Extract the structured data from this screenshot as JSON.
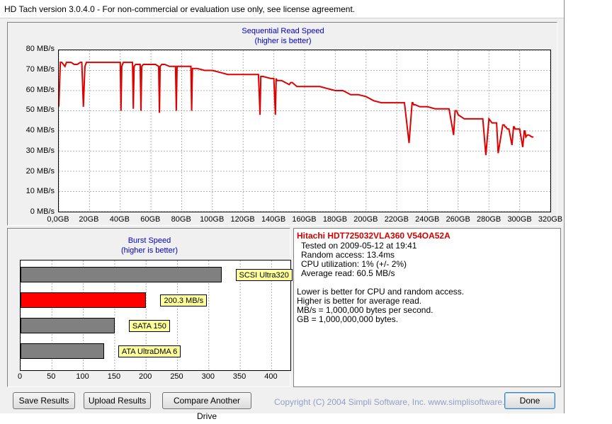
{
  "window": {
    "title": "HD Tach version 3.0.4.0  - For non-commercial or evaluation use only, see license agreement."
  },
  "sequential_chart": {
    "title": "Sequential Read Speed",
    "subtitle": "(higher is better)",
    "y_ticks": [
      "80 MB/s",
      "70 MB/s",
      "60 MB/s",
      "50 MB/s",
      "40 MB/s",
      "30 MB/s",
      "20 MB/s",
      "10 MB/s",
      "0 MB/s"
    ],
    "x_ticks": [
      "0,0GB",
      "20GB",
      "40GB",
      "60GB",
      "80GB",
      "100GB",
      "120GB",
      "140GB",
      "160GB",
      "180GB",
      "200GB",
      "220GB",
      "240GB",
      "260GB",
      "280GB",
      "300GB",
      "320GB"
    ]
  },
  "burst_chart": {
    "title": "Burst Speed",
    "subtitle": "(higher is better)",
    "x_ticks": [
      "0",
      "50",
      "100",
      "150",
      "200",
      "250",
      "300",
      "350",
      "400"
    ]
  },
  "chart_data": [
    {
      "type": "line",
      "title": "Sequential Read Speed",
      "subtitle": "(higher is better)",
      "xlabel": "",
      "ylabel": "",
      "xlim": [
        0,
        320
      ],
      "ylim": [
        0,
        80
      ],
      "grid": true,
      "color": "#e00000",
      "x": [
        0,
        1,
        2,
        4,
        5,
        6,
        8,
        10,
        12,
        14,
        15,
        16,
        17,
        18,
        20,
        30,
        40,
        40.5,
        41,
        42,
        48,
        48.5,
        49,
        50,
        53,
        53.5,
        54,
        55,
        60,
        63,
        65,
        65.5,
        66,
        67,
        69,
        72,
        75,
        76,
        76.5,
        77,
        78,
        80,
        82,
        85,
        86,
        86.5,
        87,
        88,
        90,
        95,
        100,
        105,
        110,
        118,
        125,
        130,
        131,
        131.5,
        132,
        133,
        138,
        140,
        141,
        141.5,
        142,
        143,
        145,
        150,
        151,
        152,
        155,
        160,
        165,
        170,
        175,
        180,
        185,
        190,
        195,
        200,
        205,
        210,
        220,
        225,
        228,
        230,
        230.5,
        231,
        232,
        235,
        240,
        245,
        250,
        254,
        257,
        258,
        258.5,
        259,
        260,
        264,
        270,
        275,
        276,
        278,
        280,
        282,
        283,
        284,
        285,
        286,
        289,
        290,
        290.5,
        291,
        292,
        293,
        295,
        296,
        296.5,
        297,
        298,
        300,
        302,
        303,
        303.5,
        304,
        305,
        306,
        308,
        309,
        309.5,
        310,
        312,
        315,
        318,
        320
      ],
      "y": [
        52,
        74,
        74,
        72,
        74,
        74,
        74,
        73,
        73,
        74,
        74,
        52,
        72,
        74,
        74,
        74,
        74,
        50,
        72,
        74,
        74,
        51,
        72,
        73,
        73,
        50,
        72,
        73,
        73,
        73,
        72,
        49,
        72,
        73,
        73,
        72,
        72,
        72,
        50,
        72,
        72,
        72,
        72,
        72,
        72,
        50,
        71,
        71,
        71,
        70,
        70,
        69,
        68,
        68,
        68,
        68,
        48,
        67,
        67,
        67,
        66,
        66,
        48,
        66,
        65,
        65,
        65,
        63,
        64,
        64,
        62,
        62,
        62,
        62,
        61,
        60,
        60,
        58,
        58,
        57,
        55,
        54,
        54,
        54,
        34,
        54,
        54,
        53,
        53,
        52,
        52,
        51,
        51,
        51,
        38,
        50,
        50,
        50,
        48,
        46,
        46,
        46,
        46,
        28,
        46,
        44,
        44,
        44,
        44,
        29,
        43,
        43,
        42,
        42,
        41,
        41,
        33,
        42,
        42,
        41,
        41,
        41,
        32,
        40,
        40,
        37,
        38,
        38,
        37,
        37
      ],
      "y_dips_note": ""
    },
    {
      "type": "bar",
      "title": "Burst Speed",
      "subtitle": "(higher is better)",
      "orientation": "horizontal",
      "xlim": [
        0,
        430
      ],
      "grid": true,
      "categories": [
        "SCSI Ultra320",
        "200.3 MB/s",
        "SATA 150",
        "ATA UltraDMA 6"
      ],
      "values": [
        320,
        200.3,
        150,
        133
      ],
      "colors": [
        "#808080",
        "#ff0000",
        "#808080",
        "#808080"
      ]
    }
  ],
  "info": {
    "drive_name": "Hitachi HDT725032VLA360 V54OA52A",
    "tested_on": "Tested on 2009-05-12 at 19:41",
    "random_access": "Random access: 13.4ms",
    "cpu": "CPU utilization: 1% (+/- 2%)",
    "average_read": "Average read: 60.5 MB/s",
    "note1": "Lower is better for CPU and random access.",
    "note2": "Higher is better for average read.",
    "note3": "MB/s = 1,000,000 bytes per second.",
    "note4": "GB = 1,000,000,000 bytes."
  },
  "buttons": {
    "save": "Save Results",
    "upload": "Upload Results",
    "compare": "Compare Another Drive",
    "done": "Done"
  },
  "copyright": "Copyright (C) 2004 Simpli Software, Inc. www.simplisoftware.com"
}
